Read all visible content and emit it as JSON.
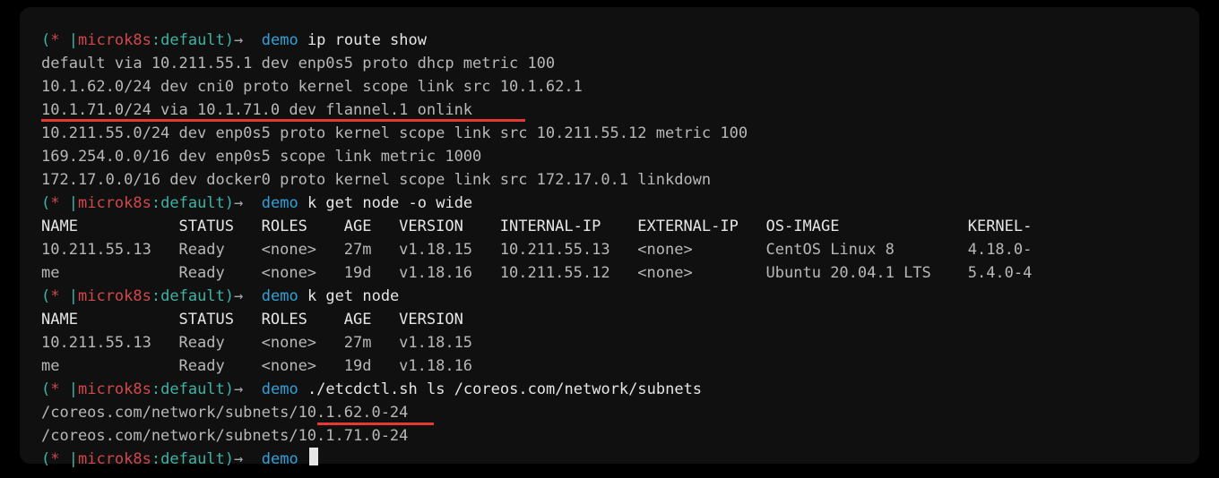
{
  "prompt": {
    "open": "(",
    "star": "* ",
    "bar": "|",
    "context": "microk8s",
    "colon": ":",
    "ns": "default",
    "close": ")",
    "arrow": "→  ",
    "demo": "demo"
  },
  "cmds": {
    "ipRoute": " ip route show",
    "getNodeWide": " k get node -o wide",
    "getNode": " k get node",
    "etcdctl": " ./etcdctl.sh ls /coreos.com/network/subnets",
    "blank": " "
  },
  "ipRouteLines": [
    "default via 10.211.55.1 dev enp0s5 proto dhcp metric 100",
    "10.1.62.0/24 dev cni0 proto kernel scope link src 10.1.62.1",
    "10.1.71.0/24 via 10.1.71.0 dev flannel.1 onlink",
    "10.211.55.0/24 dev enp0s5 proto kernel scope link src 10.211.55.12 metric 100",
    "169.254.0.0/16 dev enp0s5 scope link metric 1000",
    "172.17.0.0/16 dev docker0 proto kernel scope link src 172.17.0.1 linkdown"
  ],
  "nodeWide": {
    "header": "NAME           STATUS   ROLES    AGE   VERSION    INTERNAL-IP    EXTERNAL-IP   OS-IMAGE              KERNEL-",
    "rows": [
      "10.211.55.13   Ready    <none>   27m   v1.18.15   10.211.55.13   <none>        CentOS Linux 8        4.18.0-",
      "me             Ready    <none>   19d   v1.18.16   10.211.55.12   <none>        Ubuntu 20.04.1 LTS    5.4.0-4"
    ]
  },
  "node": {
    "header": "NAME           STATUS   ROLES    AGE   VERSION",
    "rows": [
      "10.211.55.13   Ready    <none>   27m   v1.18.15",
      "me             Ready    <none>   19d   v1.18.16"
    ]
  },
  "etcdOutput": [
    "/coreos.com/network/subnets/10.1.62.0-24",
    "/coreos.com/network/subnets/10.1.71.0-24"
  ]
}
